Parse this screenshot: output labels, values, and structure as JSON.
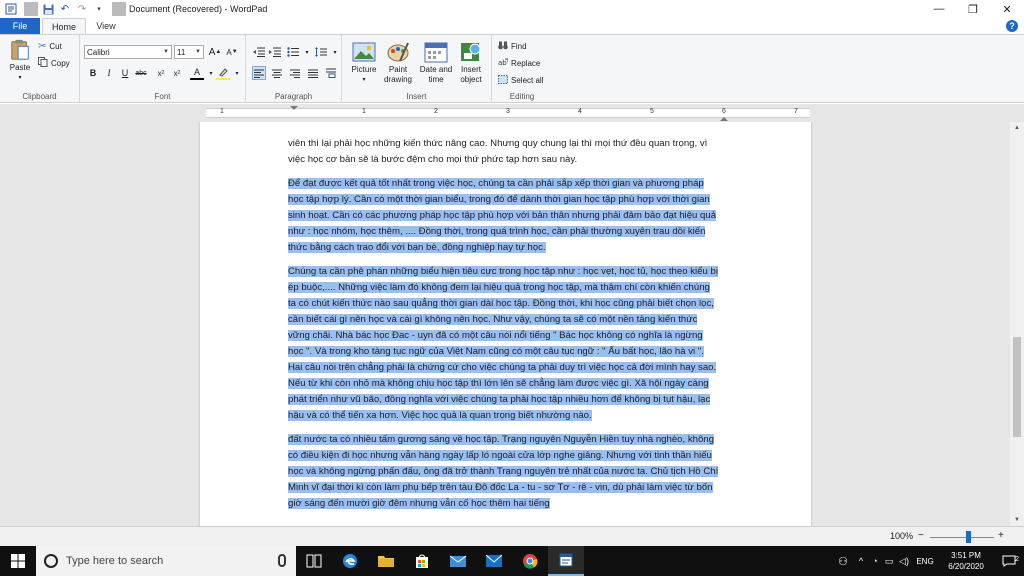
{
  "window": {
    "title": "Document (Recovered) - WordPad"
  },
  "tabs": {
    "file": "File",
    "home": "Home",
    "view": "View"
  },
  "clipboard": {
    "paste": "Paste",
    "cut": "Cut",
    "copy": "Copy",
    "label": "Clipboard"
  },
  "font": {
    "family": "Calibri",
    "size": "11",
    "label": "Font"
  },
  "paragraph": {
    "label": "Paragraph"
  },
  "insert": {
    "picture": "Picture",
    "paint_line1": "Paint",
    "paint_line2": "drawing",
    "date_line1": "Date and",
    "date_line2": "time",
    "object_line1": "Insert",
    "object_line2": "object",
    "label": "Insert"
  },
  "editing": {
    "find": "Find",
    "replace": "Replace",
    "select_all": "Select all",
    "label": "Editing"
  },
  "ruler": {
    "numbers": [
      "1",
      "1",
      "2",
      "3",
      "4",
      "5",
      "6",
      "7"
    ]
  },
  "document": {
    "p1": "viên thì lại phải học những kiến thức nâng cao. Nhưng quy chung lại thì mọi thứ đều quan trọng, vì việc học cơ bản sẽ là bước đệm cho mọi thứ phức tạp hơn sau này.",
    "p2": "Để đạt được kết quả tốt nhất trong việc học, chúng ta cần phải sắp xếp thời gian và phương pháp học tập hợp lý. Cần có một thời gian biểu, trong đó để dành thời gian học tập phù hợp với thời gian sinh hoạt. Cần có các phương pháp học tập phù hợp với bản thân nhưng phải đảm bảo đạt hiệu quả như : học nhóm, học thêm, .... Đồng thời, trong quá trình học, cần phải thường xuyên trau dồi kiến thức bằng cách trao đổi với bạn bè, đồng nghiệp hay tự học.",
    "p3": "Chúng ta cần phê phán những biểu hiện tiêu cực trong học tập như : học vẹt, học tủ, học theo kiểu bị ép buộc,.... Những việc làm đó không đem lại hiệu quả trong học tập, mà thậm chí còn khiến chúng ta có chút kiến thức nào sau quẳng thời gian dài học tập. Đồng thời, khi học cũng phải biết chọn lọc, cần biết cái gì nên học và cái gì không nên học. Như vậy, chúng ta sẽ có một nền tảng kiến thức vững chãi. Nhà bác học Đac - uyn đã có một câu nói nổi tiếng \" Bác học không có nghĩa là ngừng học \". Và trong kho tàng tục ngữ của Việt Nam cũng có một câu tục ngữ : \" Ấu bất học, lão hà vi \". Hai câu nói trên chẳng phải là chứng cứ cho việc chúng ta phải duy trì việc học cả đời mình hay sao. Nếu từ khi còn nhỏ mà không chịu học tập thì lớn lên sẽ chẳng làm được việc gì. Xã hội ngày càng phát triển như vũ bão, đồng nghĩa với việc chúng ta phải học tập nhiều hơn để không bị tụt hậu, lạc hậu và có thể tiến xa hơn. Việc học quả là quan trọng biết nhường nào.",
    "p4": "đất nước ta có nhiều tấm gương sáng về học tập. Trạng nguyên Nguyễn Hiền tuy nhà nghèo, không có điều kiện đi học nhưng vẫn hàng ngày lấp ló ngoài cửa lớp nghe giảng. Nhưng với tinh thần hiếu học và không ngừng phấn đấu, ông đã trở thành Trạng nguyên trẻ nhất của nước ta. Chủ tịch Hồ Chí Minh vĩ đại thời kì còn làm phụ bếp trên tàu Đô đốc La - tu - sơ Tơ - rê - vin, dù phải làm việc từ bốn giờ sáng đến mười giờ đêm nhưng vẫn cố học thêm hai tiếng"
  },
  "status": {
    "zoom": "100%",
    "zoom_minus": "−",
    "zoom_plus": "+",
    "zoom_level_percent": 100
  },
  "taskbar": {
    "search_placeholder": "Type here to search",
    "lang": "ENG",
    "time": "3:51 PM",
    "date": "6/20/2020",
    "notification_count": "2"
  },
  "colors": {
    "accent": "#1e66c8",
    "selection": "#99c0ec",
    "taskbar": "#101010"
  }
}
